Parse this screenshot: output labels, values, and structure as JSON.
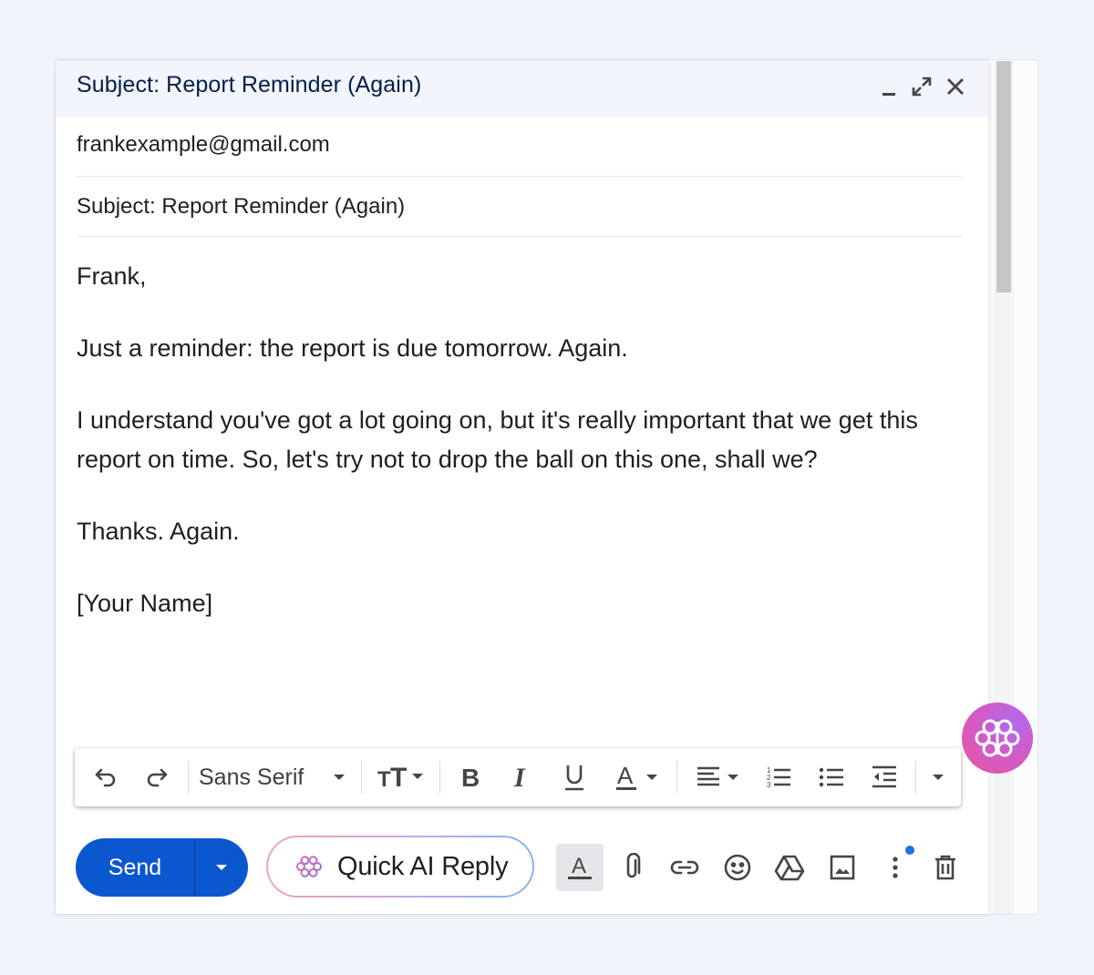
{
  "window": {
    "title": "Subject: Report Reminder (Again)"
  },
  "fields": {
    "to": "frankexample@gmail.com",
    "subject": "Subject: Report Reminder (Again)"
  },
  "body": {
    "paragraphs": [
      "Frank,",
      "Just a reminder: the report is due tomorrow. Again.",
      "I understand you've got a lot going on, but it's really important that we get this report on time. So, let's try not to drop the ball on this one, shall we?",
      "Thanks. Again.",
      "[Your Name]"
    ]
  },
  "toolbar": {
    "font_name": "Sans Serif",
    "icons": [
      "undo-icon",
      "redo-icon",
      "font-dropdown",
      "text-size-icon",
      "bold-icon",
      "italic-icon",
      "underline-icon",
      "text-color-icon",
      "align-icon",
      "numbered-list-icon",
      "bulleted-list-icon",
      "indent-less-icon",
      "more-formatting-icon"
    ]
  },
  "actions": {
    "send_label": "Send",
    "quick_ai_label": "Quick AI Reply"
  },
  "colors": {
    "send": "#0b57d0",
    "header_bg": "#f2f6fc",
    "notification_dot": "#1a73e8"
  }
}
